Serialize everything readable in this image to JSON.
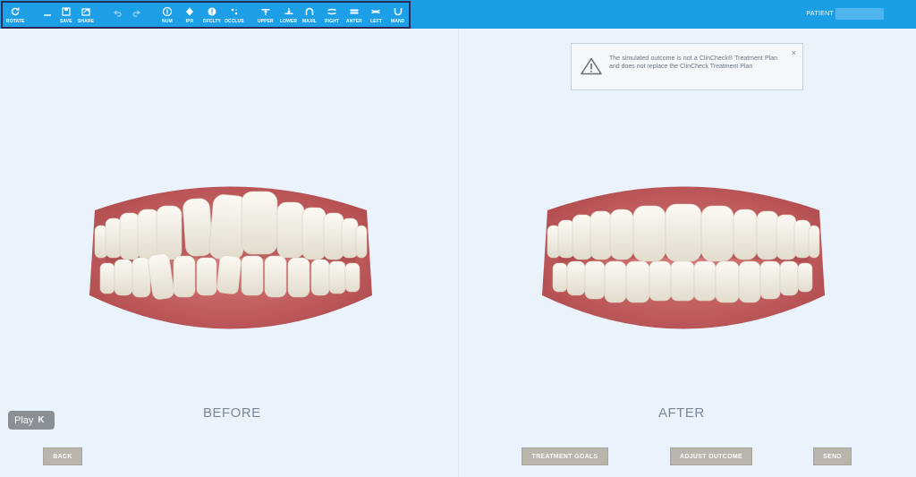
{
  "toolbar": {
    "items": [
      {
        "label": "ROTATE",
        "icon": "rotate-icon"
      },
      {
        "label": "",
        "icon": "minus-icon"
      },
      {
        "label": "SAVE",
        "icon": "save-icon"
      },
      {
        "label": "SHARE",
        "icon": "share-icon"
      },
      {
        "label": "",
        "icon": "undo-icon"
      },
      {
        "label": "",
        "icon": "redo-icon"
      },
      {
        "label": "NUM",
        "icon": "number-icon"
      },
      {
        "label": "IPR",
        "icon": "ipr-icon"
      },
      {
        "label": "DFCLTY",
        "icon": "difficulty-icon"
      },
      {
        "label": "OCCLUS",
        "icon": "occlusion-icon"
      },
      {
        "label": "UPPER",
        "icon": "upper-icon"
      },
      {
        "label": "LOWER",
        "icon": "lower-icon"
      },
      {
        "label": "MAXIL",
        "icon": "maxillary-icon"
      },
      {
        "label": "RIGHT",
        "icon": "right-view-icon"
      },
      {
        "label": "ANTER",
        "icon": "anterior-view-icon"
      },
      {
        "label": "LEFT",
        "icon": "left-view-icon"
      },
      {
        "label": "MAND",
        "icon": "mandibular-icon"
      }
    ],
    "patient_label": "PATIENT"
  },
  "notice": {
    "message": "The simulated outcome is not a ClinCheck® Treatment Plan and does not replace the ClinCheck Treatment Plan",
    "close": "×"
  },
  "panels": {
    "before": "BEFORE",
    "after": "AFTER"
  },
  "play": {
    "label": "Play",
    "key": "K"
  },
  "buttons": {
    "back": "BACK",
    "treatment_goals": "TREATMENT GOALS",
    "adjust_outcome": "ADJUST OUTCOME",
    "send": "SEND"
  },
  "colors": {
    "toolbar": "#1a9ee6",
    "background": "#eaf3fc",
    "button": "#b9b4ac",
    "gum": "#c9605f",
    "tooth": "#f4f0e6"
  }
}
